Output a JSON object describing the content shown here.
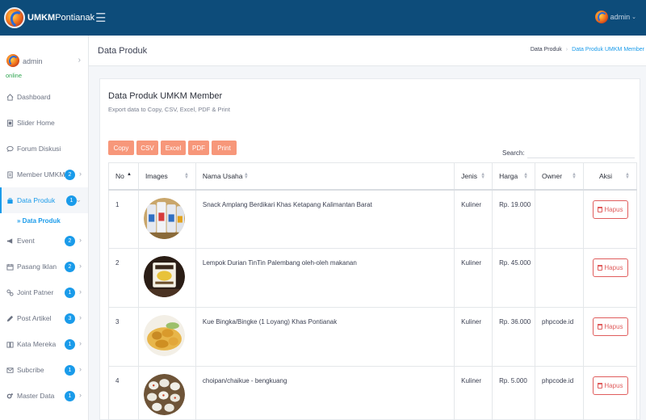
{
  "app": {
    "brand_bold": "UMKM",
    "brand_rest": "Pontianak",
    "user": "admin"
  },
  "sidebar": {
    "user_name": "admin",
    "user_status": "online",
    "items": [
      {
        "label": "Dashboard",
        "icon": "home-icon",
        "badge": ""
      },
      {
        "label": "Slider Home",
        "icon": "slider-icon",
        "badge": ""
      },
      {
        "label": "Forum Diskusi",
        "icon": "chat-icon",
        "badge": ""
      },
      {
        "label": "Member UMKM",
        "icon": "doc-icon",
        "badge": "2"
      },
      {
        "label": "Data Produk",
        "icon": "bag-icon",
        "badge": "1"
      },
      {
        "label": "Event",
        "icon": "megaphone-icon",
        "badge": "2"
      },
      {
        "label": "Pasang Iklan",
        "icon": "calendar-icon",
        "badge": "2"
      },
      {
        "label": "Joint Patner",
        "icon": "link-icon",
        "badge": "1"
      },
      {
        "label": "Post Artikel",
        "icon": "pencil-icon",
        "badge": "3"
      },
      {
        "label": "Kata Mereka",
        "icon": "book-icon",
        "badge": "1"
      },
      {
        "label": "Subcribe",
        "icon": "mail-icon",
        "badge": "1"
      },
      {
        "label": "Master Data",
        "icon": "gears-icon",
        "badge": "1"
      }
    ],
    "sub_item": "» Data Produk"
  },
  "header": {
    "title": "Data Produk",
    "breadcrumb": [
      "Data Produk",
      "Data Produk UMKM Member"
    ]
  },
  "card": {
    "title": "Data Produk UMKM Member",
    "subtitle": "Export data to Copy, CSV, Excel, PDF & Print",
    "buttons": [
      "Copy",
      "CSV",
      "Excel",
      "PDF",
      "Print"
    ],
    "search_label": "Search:",
    "search_value": ""
  },
  "table": {
    "columns": [
      "No",
      "Images",
      "Nama Usaha",
      "Jenis",
      "Harga",
      "Owner",
      "Aksi"
    ],
    "action_label": "Hapus",
    "rows": [
      {
        "no": "1",
        "image": "snack-amplang-photo",
        "nama": "Snack Amplang Berdikari Khas Ketapang Kalimantan Barat",
        "jenis": "Kuliner",
        "harga": "Rp. 19.000",
        "owner": ""
      },
      {
        "no": "2",
        "image": "lempok-durian-photo",
        "nama": "Lempok Durian TinTin Palembang oleh-oleh makanan",
        "jenis": "Kuliner",
        "harga": "Rp. 45.000",
        "owner": ""
      },
      {
        "no": "3",
        "image": "kue-bingka-photo",
        "nama": "Kue Bingka/Bingke (1 Loyang) Khas Pontianak",
        "jenis": "Kuliner",
        "harga": "Rp. 36.000",
        "owner": "phpcode.id"
      },
      {
        "no": "4",
        "image": "choipan-photo",
        "nama": "choipan/chaikue - bengkuang",
        "jenis": "Kuliner",
        "harga": "Rp. 5.000",
        "owner": "phpcode.id"
      }
    ]
  },
  "colors": {
    "topbar": "#0d4c7a",
    "accent": "#1a9bea",
    "export_button": "#f7977a",
    "danger": "#e05d5d"
  }
}
